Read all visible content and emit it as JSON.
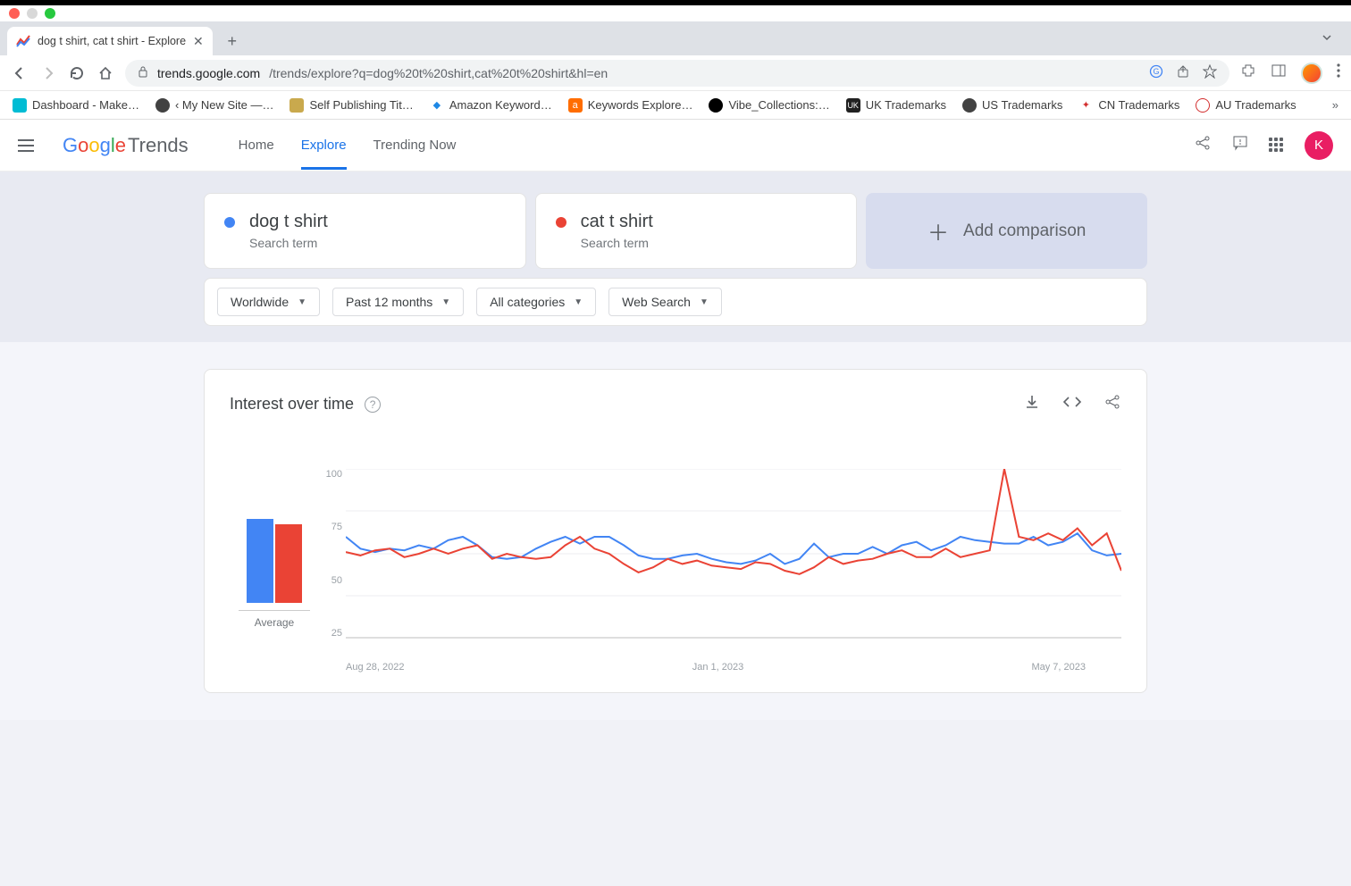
{
  "browser": {
    "tab_title": "dog t shirt, cat t shirt - Explore",
    "url_host": "trends.google.com",
    "url_path": "/trends/explore?q=dog%20t%20shirt,cat%20t%20shirt&hl=en",
    "bookmarks": [
      "Dashboard - Make…",
      "‹ My New Site —…",
      "Self Publishing Tit…",
      "Amazon Keyword…",
      "Keywords Explore…",
      "Vibe_Collections:…",
      "UK Trademarks",
      "US Trademarks",
      "CN Trademarks",
      "AU Trademarks"
    ]
  },
  "header": {
    "logo_left": "Google",
    "logo_right": "Trends",
    "nav": {
      "home": "Home",
      "explore": "Explore",
      "trending": "Trending Now"
    },
    "avatar_initial": "K"
  },
  "compare": {
    "terms": [
      {
        "title": "dog t shirt",
        "subtitle": "Search term",
        "color": "#4285F4"
      },
      {
        "title": "cat t shirt",
        "subtitle": "Search term",
        "color": "#EA4335"
      }
    ],
    "add_label": "Add comparison"
  },
  "filters": {
    "geo": "Worldwide",
    "time": "Past 12 months",
    "category": "All categories",
    "search_type": "Web Search"
  },
  "chart": {
    "title": "Interest over time",
    "avg_label": "Average"
  },
  "chart_data": {
    "type": "line",
    "title": "Interest over time",
    "ylabel": "",
    "xlabel": "",
    "ylim": [
      0,
      100
    ],
    "y_ticks": [
      25,
      50,
      75,
      100
    ],
    "x_tick_labels": [
      "Aug 28, 2022",
      "Jan 1, 2023",
      "May 7, 2023"
    ],
    "average_bars": {
      "dog t shirt": 52,
      "cat t shirt": 49
    },
    "series": [
      {
        "name": "dog t shirt",
        "color": "#4285F4",
        "values": [
          60,
          53,
          51,
          53,
          52,
          55,
          53,
          58,
          60,
          55,
          48,
          47,
          48,
          53,
          57,
          60,
          56,
          60,
          60,
          55,
          49,
          47,
          47,
          49,
          50,
          47,
          45,
          44,
          46,
          50,
          44,
          47,
          56,
          48,
          50,
          50,
          54,
          50,
          55,
          57,
          52,
          55,
          60,
          58,
          57,
          56,
          56,
          60,
          55,
          57,
          62,
          52,
          49,
          50
        ]
      },
      {
        "name": "cat t shirt",
        "color": "#EA4335",
        "values": [
          51,
          49,
          52,
          53,
          48,
          50,
          53,
          50,
          53,
          55,
          47,
          50,
          48,
          47,
          48,
          55,
          60,
          53,
          50,
          44,
          39,
          42,
          47,
          44,
          46,
          43,
          42,
          41,
          45,
          44,
          40,
          38,
          42,
          48,
          44,
          46,
          47,
          50,
          52,
          48,
          48,
          53,
          48,
          50,
          52,
          100,
          60,
          58,
          62,
          58,
          65,
          55,
          62,
          40
        ]
      }
    ]
  }
}
